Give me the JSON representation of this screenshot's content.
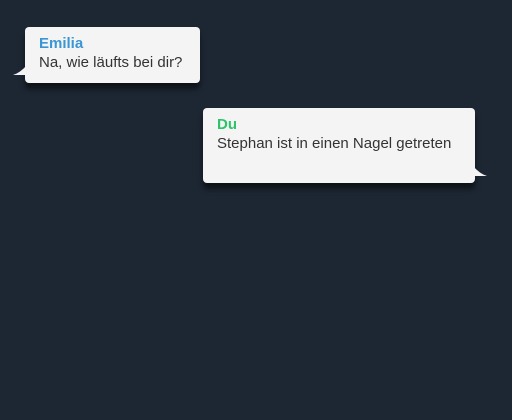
{
  "colors": {
    "background": "#1d2734",
    "bubble": "#f4f4f4",
    "contact_name": "#3b96d4",
    "self_name": "#2ec46b",
    "message_text": "#333333"
  },
  "messages": [
    {
      "sender": "Emilia",
      "text": "Na, wie läufts bei dir?",
      "direction": "incoming"
    },
    {
      "sender": "Du",
      "text": "Stephan ist in einen Nagel getreten",
      "direction": "outgoing"
    }
  ]
}
